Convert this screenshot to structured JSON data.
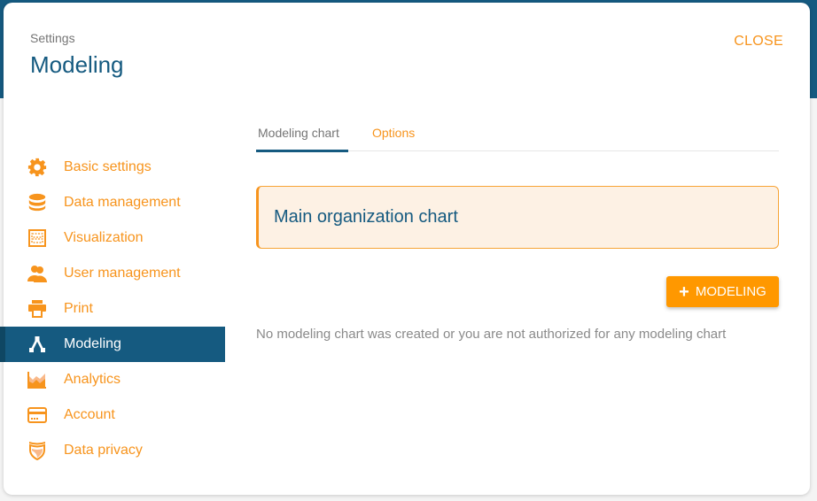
{
  "colors": {
    "brand_blue": "#155a80",
    "accent_orange": "#f7941d",
    "button_orange": "#ff9800",
    "card_background": "#fdf1e4"
  },
  "header": {
    "subtitle": "Settings",
    "title": "Modeling",
    "close_label": "CLOSE"
  },
  "sidebar": {
    "items": [
      {
        "label": "Basic settings",
        "icon": "gear-icon"
      },
      {
        "label": "Data management",
        "icon": "database-icon"
      },
      {
        "label": "Visualization",
        "icon": "visualization-icon"
      },
      {
        "label": "User management",
        "icon": "users-icon"
      },
      {
        "label": "Print",
        "icon": "printer-icon"
      },
      {
        "label": "Modeling",
        "icon": "modeling-icon",
        "active": true
      },
      {
        "label": "Analytics",
        "icon": "analytics-icon"
      },
      {
        "label": "Account",
        "icon": "credit-card-icon"
      },
      {
        "label": "Data privacy",
        "icon": "shield-icon"
      }
    ]
  },
  "main": {
    "tabs": [
      {
        "label": "Modeling chart",
        "active": true
      },
      {
        "label": "Options",
        "active": false
      }
    ],
    "chart_card": {
      "title": "Main organization chart"
    },
    "add_button": {
      "label": "MODELING",
      "icon": "plus-icon"
    },
    "empty_message": "No modeling chart was created or you are not authorized for any modeling chart"
  }
}
